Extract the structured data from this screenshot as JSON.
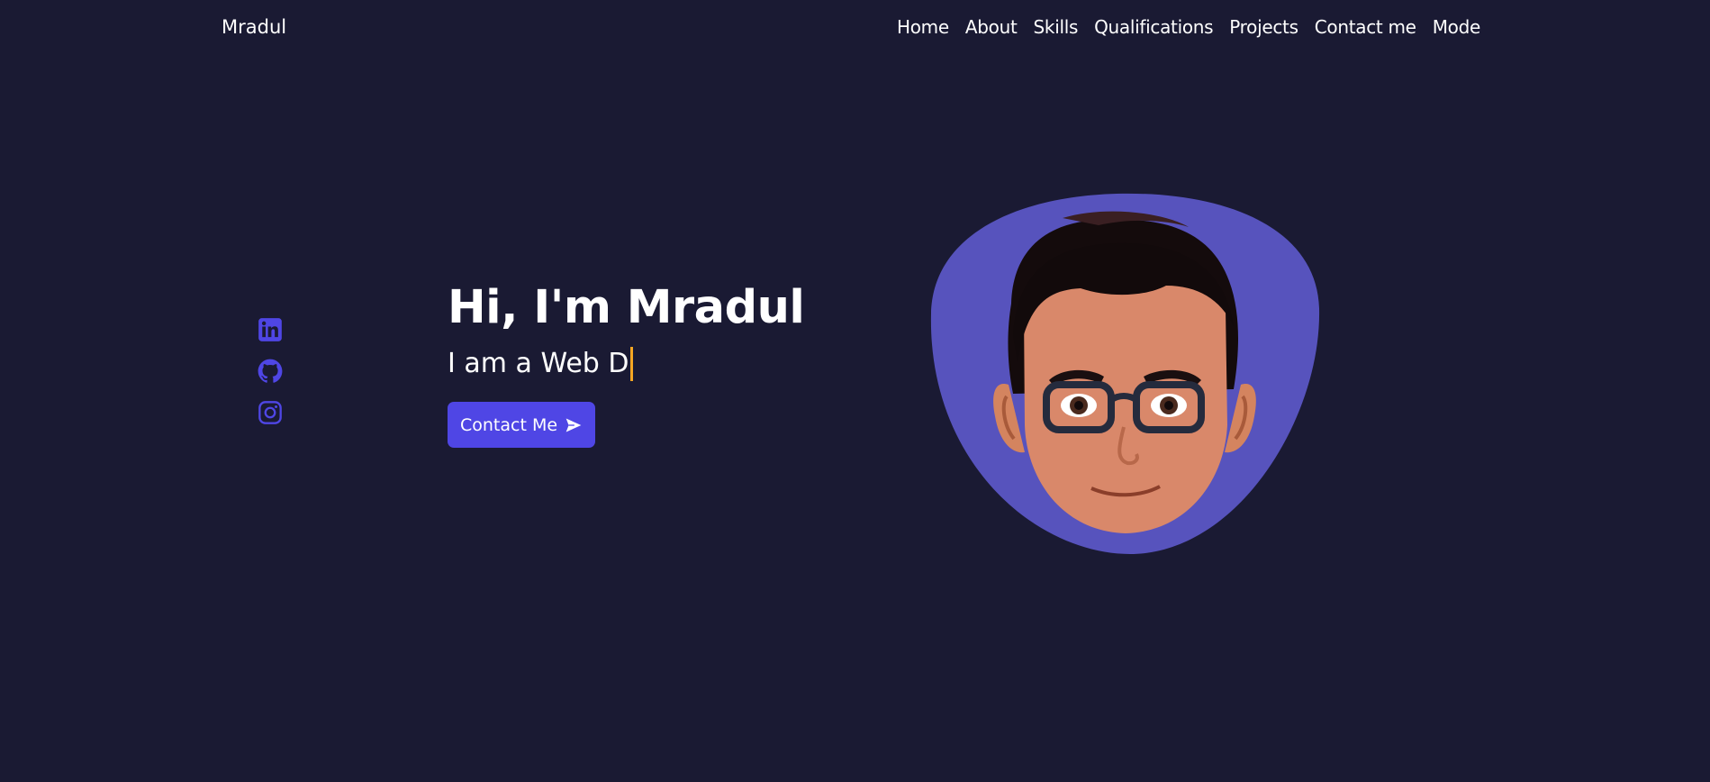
{
  "navbar": {
    "logo": "Mradul",
    "links": [
      "Home",
      "About",
      "Skills",
      "Qualifications",
      "Projects",
      "Contact me",
      "Mode"
    ]
  },
  "social": {
    "items": [
      {
        "icon": "linkedin-icon"
      },
      {
        "icon": "github-icon"
      },
      {
        "icon": "instagram-icon"
      }
    ]
  },
  "hero": {
    "title": "Hi, I'm Mradul",
    "subtitle": "I am a Web D",
    "button_label": "Contact Me",
    "button_icon": "send-icon"
  },
  "avatar": {
    "icon": "avatar-illustration"
  },
  "colors": {
    "background": "#1a1a33",
    "accent": "#4f46e5",
    "blob": "#5753bd",
    "cursor": "#f5a623",
    "text": "#ffffff"
  }
}
